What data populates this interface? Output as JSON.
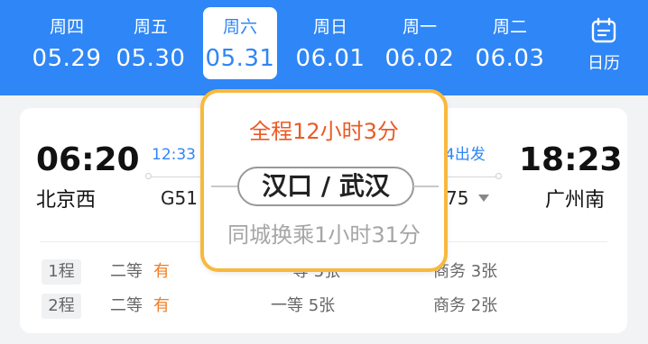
{
  "date_bar": {
    "days": [
      {
        "weekday": "周四",
        "date": "05.29",
        "selected": false
      },
      {
        "weekday": "周五",
        "date": "05.30",
        "selected": false
      },
      {
        "weekday": "周六",
        "date": "05.31",
        "selected": true
      },
      {
        "weekday": "周日",
        "date": "06.01",
        "selected": false
      },
      {
        "weekday": "周一",
        "date": "06.02",
        "selected": false
      },
      {
        "weekday": "周二",
        "date": "06.03",
        "selected": false
      }
    ],
    "calendar_label": "日历",
    "calendar_icon": "calendar-icon"
  },
  "trip": {
    "depart_time": "06:20",
    "depart_station": "北京西",
    "arrive_time": "18:23",
    "arrive_station": "广州南",
    "leg1_time": "12:33",
    "leg1_train": "G51",
    "leg2_time": "4出发",
    "leg2_train": "75",
    "segments": [
      {
        "badge": "1程",
        "seats": [
          {
            "class": "二等",
            "avail": "有"
          },
          {
            "class": "等",
            "avail": "5张"
          },
          {
            "class": "商务",
            "avail": "3张"
          }
        ]
      },
      {
        "badge": "2程",
        "seats": [
          {
            "class": "二等",
            "avail": "有"
          },
          {
            "class": "一等",
            "avail": "5张"
          },
          {
            "class": "商务",
            "avail": "2张"
          }
        ]
      }
    ]
  },
  "popup": {
    "total_duration": "全程12小时3分",
    "transfer_station": "汉口 / 武汉",
    "transfer_info": "同城换乘1小时31分"
  },
  "colors": {
    "brand_blue": "#2f86f6",
    "accent_orange": "#ea5a25",
    "popup_border": "#f7b93d"
  }
}
